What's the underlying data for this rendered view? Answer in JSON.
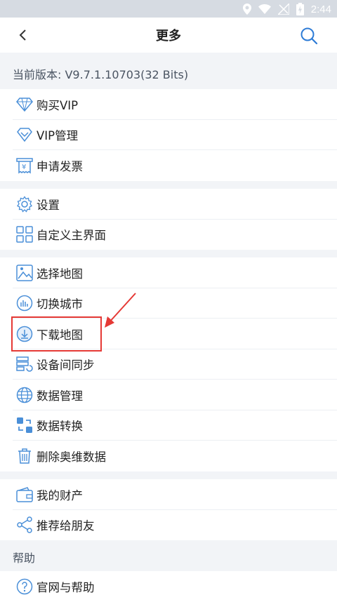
{
  "status_bar": {
    "time": "2:44"
  },
  "header": {
    "title": "更多"
  },
  "version": {
    "text": "当前版本: V9.7.1.10703(32 Bits)"
  },
  "group1": {
    "items": [
      {
        "label": "购买VIP",
        "icon": "diamond-icon"
      },
      {
        "label": "VIP管理",
        "icon": "vip-diamond-icon"
      },
      {
        "label": "申请发票",
        "icon": "invoice-icon"
      }
    ]
  },
  "group2": {
    "items": [
      {
        "label": "设置",
        "icon": "gear-icon"
      },
      {
        "label": "自定义主界面",
        "icon": "grid-icon"
      }
    ]
  },
  "group3": {
    "items": [
      {
        "label": "选择地图",
        "icon": "map-icon"
      },
      {
        "label": "切换城市",
        "icon": "city-icon"
      },
      {
        "label": "下载地图",
        "icon": "download-icon"
      },
      {
        "label": "设备间同步",
        "icon": "sync-icon"
      },
      {
        "label": "数据管理",
        "icon": "globe-icon"
      },
      {
        "label": "数据转换",
        "icon": "convert-icon"
      },
      {
        "label": "删除奥维数据",
        "icon": "trash-icon"
      }
    ]
  },
  "group4": {
    "items": [
      {
        "label": "我的财产",
        "icon": "wallet-icon"
      },
      {
        "label": "推荐给朋友",
        "icon": "share-icon"
      }
    ]
  },
  "help": {
    "section_label": "帮助",
    "items": [
      {
        "label": "官网与帮助",
        "icon": "help-icon"
      }
    ]
  },
  "colors": {
    "icon_blue": "#4a8fd8",
    "highlight": "#e53935",
    "header_blue": "#2d7bd6"
  }
}
